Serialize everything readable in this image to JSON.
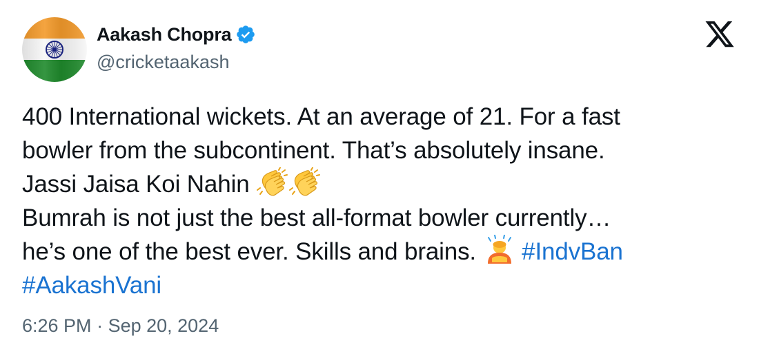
{
  "author": {
    "display_name": "Aakash Chopra",
    "handle": "@cricketaakash",
    "verified": true,
    "avatar_icon": "india-flag-icon"
  },
  "brand": {
    "logo_icon": "x-logo-icon"
  },
  "tweet": {
    "line1": "400 International wickets. At an average of 21. For a fast",
    "line2": "bowler from the subcontinent. That’s absolutely insane.",
    "line3_text": "Jassi Jaisa Koi Nahin ",
    "line3_emoji": [
      "clapping-hands-icon",
      "clapping-hands-icon"
    ],
    "line4": "Bumrah is not just the best all-format bowler currently…",
    "line5_text": "he’s one of the best ever. Skills and brains. ",
    "line5_emoji": "person-bowing-icon",
    "hashtags": [
      "#IndvBan",
      "#AakashVani"
    ]
  },
  "timestamp": {
    "time": "6:26 PM",
    "separator": " · ",
    "date": "Sep 20, 2024"
  },
  "colors": {
    "text": "#0f1419",
    "secondary": "#536471",
    "link": "#1a73d1",
    "verified": "#1d9bf0",
    "saffron": "#f39a2b",
    "green": "#1f8a2c",
    "chakra": "#1a237e"
  }
}
